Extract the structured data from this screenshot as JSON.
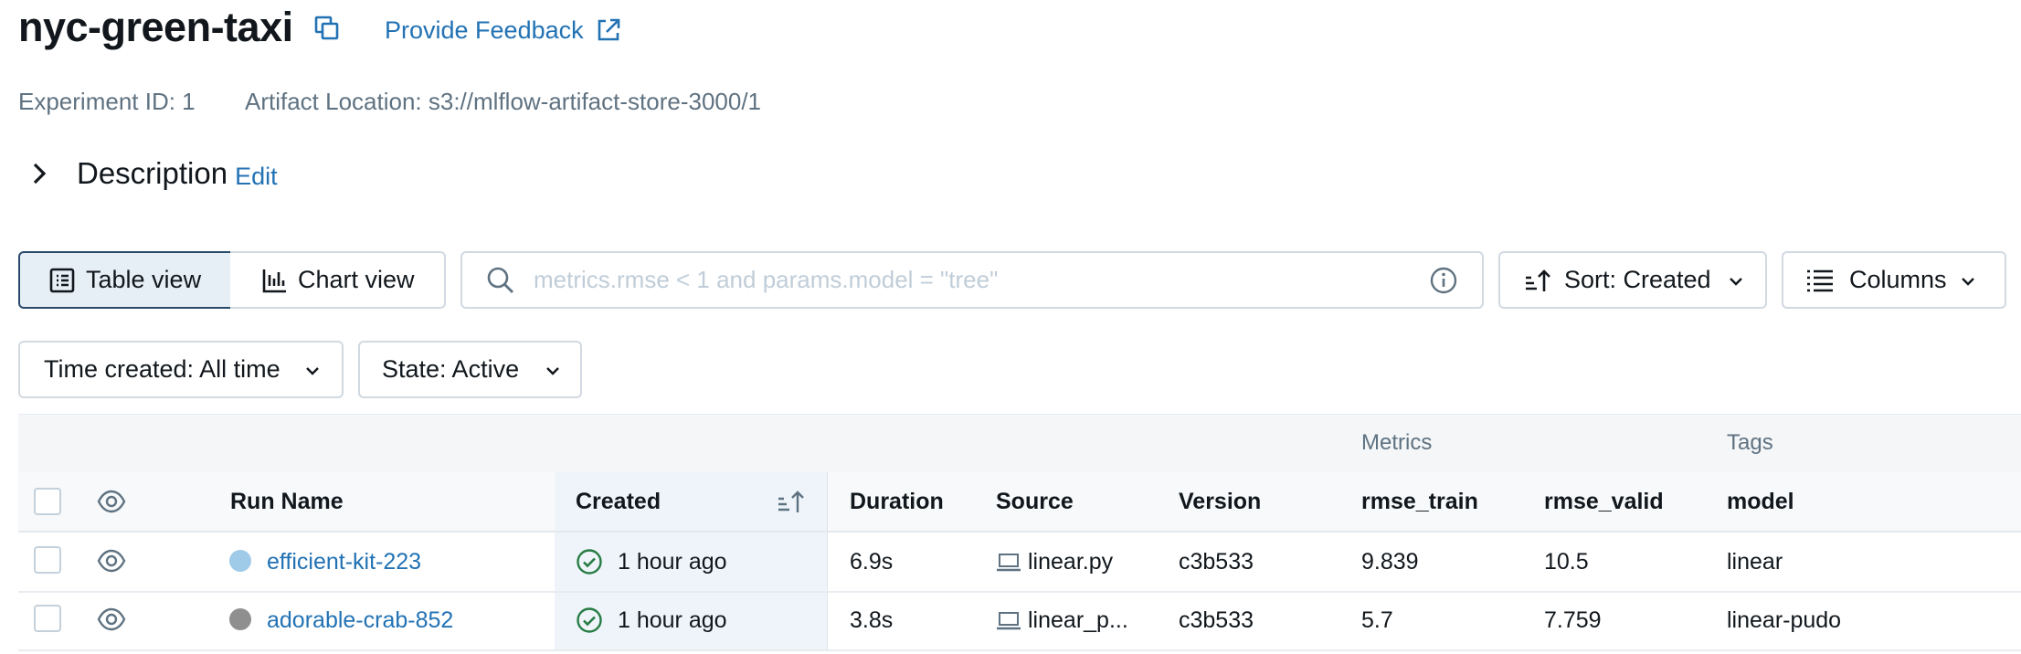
{
  "header": {
    "title": "nyc-green-taxi",
    "feedback_label": "Provide Feedback",
    "experiment_id": "Experiment ID: 1",
    "artifact_location": "Artifact Location: s3://mlflow-artifact-store-3000/1"
  },
  "description": {
    "label": "Description",
    "edit_label": "Edit"
  },
  "toolbar": {
    "table_view_label": "Table view",
    "chart_view_label": "Chart view",
    "search_placeholder": "metrics.rmse < 1 and params.model = \"tree\"",
    "search_value": "",
    "sort_label": "Sort: Created",
    "columns_label": "Columns"
  },
  "filters": {
    "time_created": "Time created: All time",
    "state": "State: Active"
  },
  "table": {
    "groups": {
      "metrics": "Metrics",
      "tags": "Tags"
    },
    "columns": {
      "run_name": "Run Name",
      "created": "Created",
      "duration": "Duration",
      "source": "Source",
      "version": "Version",
      "rmse_train": "rmse_train",
      "rmse_valid": "rmse_valid",
      "model": "model"
    },
    "rows": [
      {
        "run_name": "efficient-kit-223",
        "color": "#9fcbe8",
        "created": "1 hour ago",
        "duration": "6.9s",
        "source": "linear.py",
        "version": "c3b533",
        "rmse_train": "9.839",
        "rmse_valid": "10.5",
        "model": "linear"
      },
      {
        "run_name": "adorable-crab-852",
        "color": "#8f8f8f",
        "created": "1 hour ago",
        "duration": "3.8s",
        "source": "linear_p...",
        "version": "c3b533",
        "rmse_train": "5.7",
        "rmse_valid": "7.759",
        "model": "linear-pudo"
      }
    ]
  },
  "colors": {
    "link": "#2272b4",
    "success": "#277c43",
    "selected_bg": "#e6eef6"
  },
  "icons": [
    "copy-icon",
    "external-link-icon",
    "chevron-right-icon",
    "table-icon",
    "bar-chart-icon",
    "search-icon",
    "info-icon",
    "sort-ascending-icon",
    "chevron-down-icon",
    "list-icon",
    "eye-icon",
    "check-circle-icon",
    "laptop-icon"
  ]
}
